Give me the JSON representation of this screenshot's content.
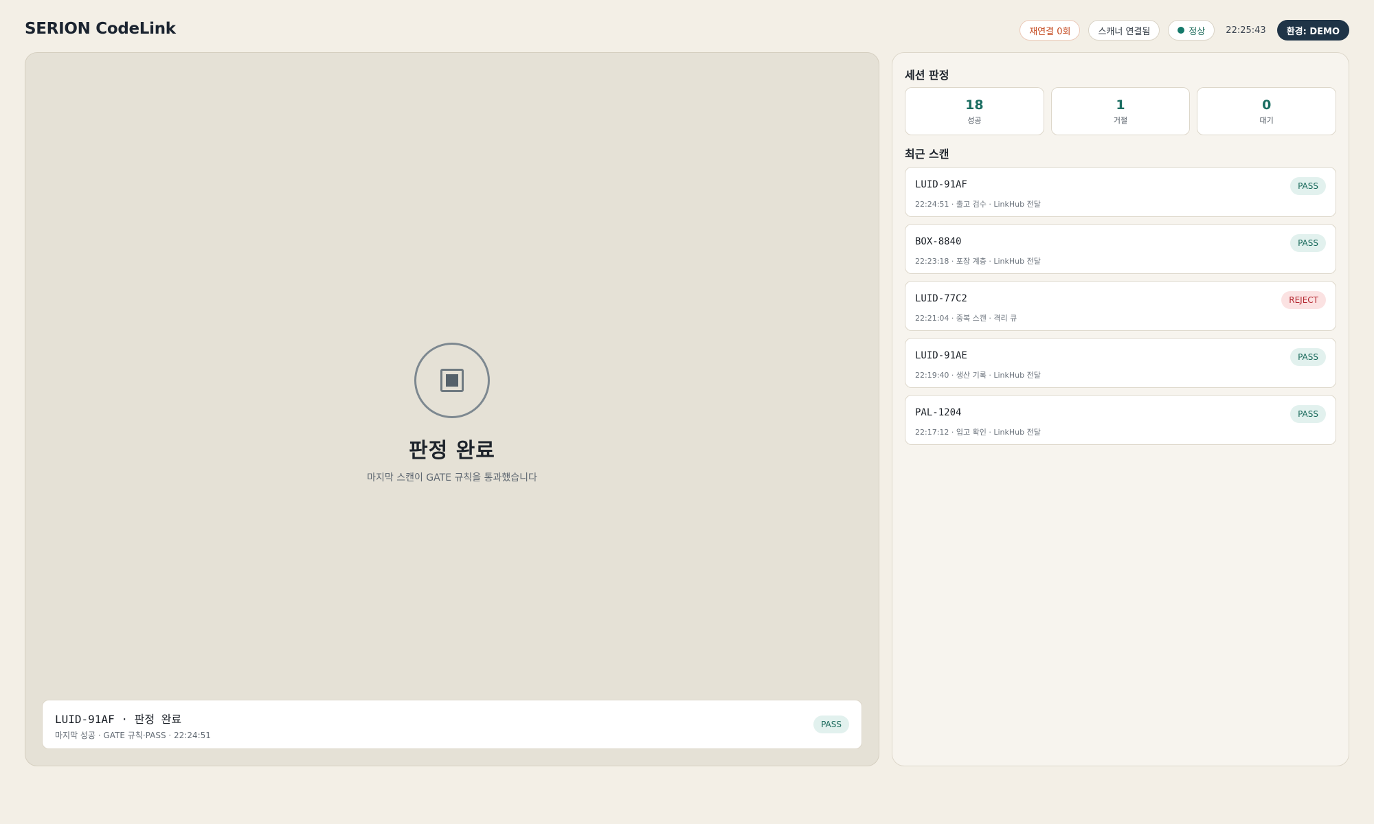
{
  "header": {
    "brand": "SERION CodeLink",
    "reconnect_label": "재연결 0회",
    "scanner_label": "스캐너 연결됨",
    "status_label": "정상",
    "clock": "22:25:43",
    "env_label": "환경: DEMO"
  },
  "stage": {
    "title": "판정 완료",
    "subtitle": "마지막 스캔이 GATE 규칙을 통과했습니다",
    "result": {
      "main": "LUID-91AF  ·  판정 완료",
      "detail": "마지막 성공 · GATE 규칙·PASS · 22:24:51",
      "badge": "PASS"
    }
  },
  "session": {
    "title": "세션 판정",
    "stats": [
      {
        "value": "18",
        "label": "성공"
      },
      {
        "value": "1",
        "label": "거절"
      },
      {
        "value": "0",
        "label": "대기"
      }
    ]
  },
  "recent": {
    "title": "최근 스캔",
    "items": [
      {
        "id": "LUID-91AF",
        "meta": "22:24:51 · 출고 검수 · LinkHub 전달",
        "badge": "PASS",
        "status": "pass"
      },
      {
        "id": "BOX-8840",
        "meta": "22:23:18 · 포장 계층 · LinkHub 전달",
        "badge": "PASS",
        "status": "pass"
      },
      {
        "id": "LUID-77C2",
        "meta": "22:21:04 · 중복 스캔 · 격리 큐",
        "badge": "REJECT",
        "status": "reject"
      },
      {
        "id": "LUID-91AE",
        "meta": "22:19:40 · 생산 기록 · LinkHub 전달",
        "badge": "PASS",
        "status": "pass"
      },
      {
        "id": "PAL-1204",
        "meta": "22:17:12 · 입고 확인 · LinkHub 전달",
        "badge": "PASS",
        "status": "pass"
      }
    ]
  },
  "colors": {
    "accent": "#14796a",
    "reject": "#b3252e",
    "env_bg": "#1f3447"
  }
}
